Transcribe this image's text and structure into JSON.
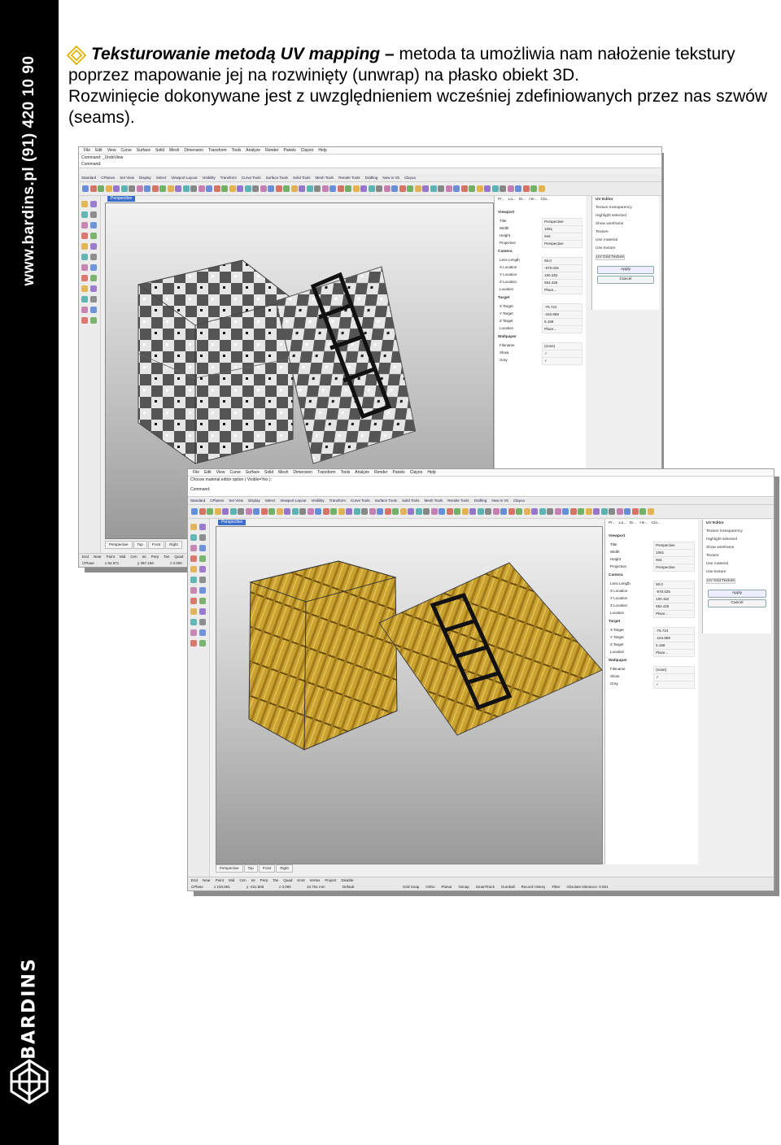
{
  "sidebar": {
    "url": "www.bardins.pl  (91) 420 10 90",
    "brand": "BARDINS",
    "color": "#000000"
  },
  "paragraph": {
    "lead": "Teksturowanie metodą UV mapping –",
    "body": " metoda ta umożliwia nam nałożenie tekstury poprzez mapowanie jej na rozwinięty (unwrap) na płasko obiekt 3D.",
    "body2": "Rozwinięcie dokonywane jest z uwzględnieniem wcześniej zdefiniowanych przez nas szwów (seams)."
  },
  "rhino": {
    "menu": [
      "File",
      "Edit",
      "View",
      "Curve",
      "Surface",
      "Solid",
      "Mesh",
      "Dimension",
      "Transform",
      "Tools",
      "Analyze",
      "Render",
      "Panels",
      "Clayoo",
      "Help"
    ],
    "tabs": [
      "Standard",
      "CPlanes",
      "Set View",
      "Display",
      "Select",
      "Viewport Layout",
      "Visibility",
      "Transform",
      "Curve Tools",
      "Surface Tools",
      "Solid Tools",
      "Mesh Tools",
      "Render Tools",
      "Drafting",
      "New in V5",
      "Clayoo"
    ],
    "viewport_name": "Perspective",
    "panel_tabs": [
      "Pr...",
      "La...",
      "Di...",
      "He...",
      "Cla..."
    ],
    "viewport_section": "Viewport",
    "props": [
      {
        "k": "Title",
        "v": "Perspective"
      },
      {
        "k": "Width",
        "v": "1061"
      },
      {
        "k": "Height",
        "v": "944"
      },
      {
        "k": "Projection",
        "v": "Perspective"
      }
    ],
    "camera_section": "Camera",
    "camera": [
      {
        "k": "Lens Length",
        "v": "50.0"
      },
      {
        "k": "X Location",
        "v": "-570.025"
      },
      {
        "k": "Y Location",
        "v": "100.152"
      },
      {
        "k": "Z Location",
        "v": "554.425"
      },
      {
        "k": "Location",
        "v": "Place..."
      }
    ],
    "target_section": "Target",
    "target": [
      {
        "k": "X Target",
        "v": "-75.724"
      },
      {
        "k": "Y Target",
        "v": "-164.859"
      },
      {
        "k": "Z Target",
        "v": "5.168"
      },
      {
        "k": "Location",
        "v": "Place..."
      }
    ],
    "wallpaper_section": "Wallpaper",
    "wallpaper": [
      {
        "k": "Filename",
        "v": "(none)"
      },
      {
        "k": "Show",
        "v": "✓"
      },
      {
        "k": "Gray",
        "v": "✓"
      }
    ],
    "uv_editor": {
      "title": "UV Editor",
      "transparency": "Texture transparency",
      "highlight": "Highlight selected",
      "wireframe": "Show wireframe",
      "texture": "Texture",
      "use_material": "Use material",
      "use_texture": "Use texture",
      "texture_name": "UV Grid Texture",
      "apply": "Apply",
      "cancel": "Cancel"
    },
    "view_tabs": [
      "Perspective",
      "Top",
      "Front",
      "Right"
    ],
    "osnaps": [
      "End",
      "Near",
      "Point",
      "Mid",
      "Cen",
      "Int",
      "Perp",
      "Tan",
      "Quad",
      "Knot",
      "Vertex",
      "Project",
      "Disable"
    ],
    "shot1": {
      "command1": "Command: _UndoView",
      "command2": "Command:",
      "status_cplane": "CPlane",
      "status_x": "x 64.971",
      "status_y": "y 397.169",
      "status_z": "z 0.000"
    },
    "shot2": {
      "command1": "Choose material editor option ( Visible=Yes ):",
      "command2": "Command:",
      "status_cplane": "CPlane",
      "status_x": "x 103.691",
      "status_y": "y -431.806",
      "status_z": "z 0.000",
      "status_mm": "10.751 mm",
      "status_layer": "Default",
      "status_items": [
        "Grid Snap",
        "Ortho",
        "Planar",
        "Osnap",
        "SmartTrack",
        "Gumball",
        "Record History",
        "Filter",
        "Absolute tolerance: 0.001"
      ]
    }
  }
}
